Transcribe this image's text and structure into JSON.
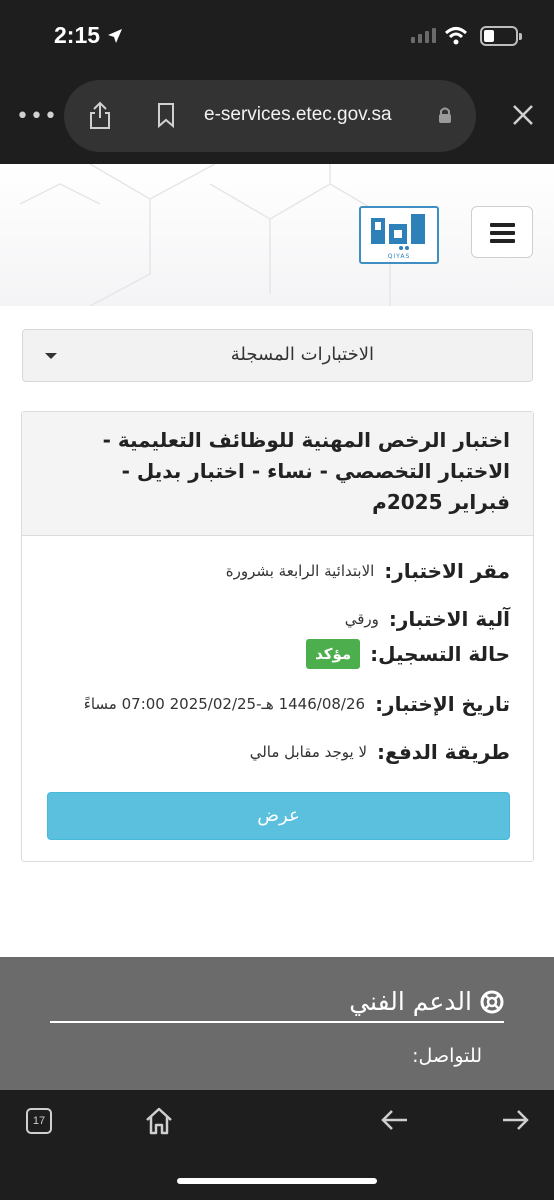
{
  "status_bar": {
    "time": "2:15"
  },
  "browser": {
    "url": "e-services.etec.gov.sa",
    "tab_count": "17"
  },
  "header": {
    "logo_text": "QIYAS"
  },
  "dropdown": {
    "label": "الاختبارات المسجلة"
  },
  "card": {
    "title": "اختبار الرخص المهنية للوظائف التعليمية - الاختبار التخصصي - نساء - اختبار بديل - فبراير 2025م",
    "fields": {
      "location_label": "مقر الاختبار:",
      "location_value": "الابتدائية الرابعة بشرورة",
      "method_label": "آلية الاختبار:",
      "method_value": "ورقي",
      "status_label": "حالة التسجيل:",
      "status_value": "مؤكد",
      "date_label": "تاريخ الإختبار:",
      "date_value": "1446/08/26 هـ-2025/02/25 07:00 مساءً",
      "payment_label": "طريقة الدفع:",
      "payment_value": "لا يوجد مقابل مالي"
    },
    "view_button": "عرض"
  },
  "footer": {
    "support_title": "الدعم الفني",
    "contact_label": "للتواصل:"
  },
  "colors": {
    "success": "#4cae4c",
    "info": "#5bc0de",
    "footer": "#6b6b6b",
    "chrome": "#1e1e1e"
  }
}
